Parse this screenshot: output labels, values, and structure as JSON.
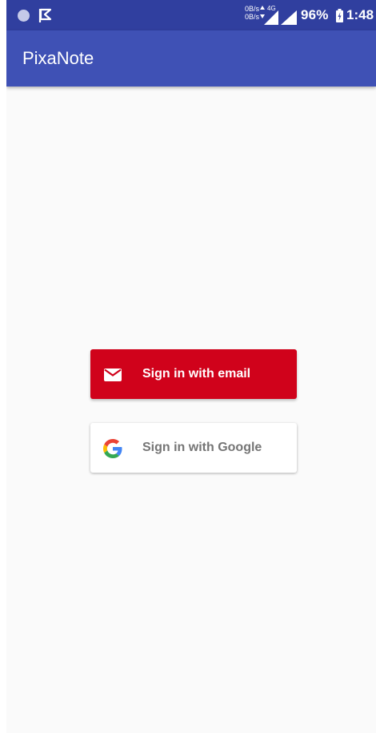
{
  "status_bar": {
    "net_speed_up": "0B/s",
    "net_speed_down": "0B/s",
    "network_type": "4G",
    "battery_percent": "96%",
    "time": "1:48",
    "icons": [
      "notification-dot-icon",
      "flag-icon",
      "data-arrows-icon",
      "signal-icon",
      "battery-charging-icon"
    ]
  },
  "app_bar": {
    "title": "PixaNote"
  },
  "auth": {
    "email_button": {
      "label": "Sign in with email",
      "icon": "mail-icon",
      "color": "#d0021b"
    },
    "google_button": {
      "label": "Sign in with Google",
      "icon": "google-g-icon",
      "color": "#ffffff"
    }
  },
  "colors": {
    "primary": "#3f51b5",
    "primary_dark": "#303f9f",
    "background": "#fafafa"
  }
}
